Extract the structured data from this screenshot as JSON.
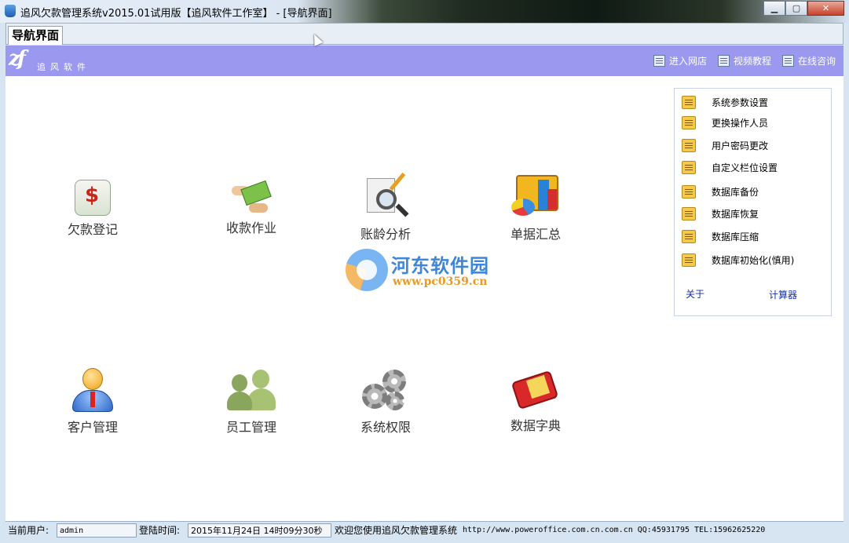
{
  "window": {
    "title": "追风欠款管理系统v2015.01试用版【追风软件工作室】 - [导航界面]",
    "minimize": "▁",
    "maximize": "▢",
    "close": "✕"
  },
  "tabs": [
    {
      "label": "导航界面"
    }
  ],
  "header": {
    "logo_mark": "zf",
    "logo_text": "追风软件",
    "links": [
      {
        "label": "进入网店",
        "icon": "list-icon"
      },
      {
        "label": "视频教程",
        "icon": "list-icon"
      },
      {
        "label": "在线咨询",
        "icon": "list-icon"
      }
    ]
  },
  "nav": {
    "items": [
      {
        "label": "欠款登记",
        "icon": "debt-register-icon"
      },
      {
        "label": "收款作业",
        "icon": "money-collect-icon"
      },
      {
        "label": "账龄分析",
        "icon": "magnifier-report-icon"
      },
      {
        "label": "单据汇总",
        "icon": "chart-summary-icon"
      },
      {
        "label": "客户管理",
        "icon": "customer-icon"
      },
      {
        "label": "员工管理",
        "icon": "staff-icon"
      },
      {
        "label": "系统权限",
        "icon": "gears-icon"
      },
      {
        "label": "数据字典",
        "icon": "dictionary-book-icon"
      }
    ]
  },
  "watermark": {
    "name": "河东软件园",
    "url": "www.pc0359.cn"
  },
  "side_panel": {
    "items": [
      {
        "label": "系统参数设置"
      },
      {
        "label": "更换操作人员"
      },
      {
        "label": "用户密码更改"
      },
      {
        "label": "自定义栏位设置"
      },
      {
        "label": "数据库备份"
      },
      {
        "label": "数据库恢复"
      },
      {
        "label": "数据库压缩"
      },
      {
        "label": "数据库初始化(慎用)"
      }
    ],
    "about": "关于",
    "calculator": "计算器"
  },
  "status": {
    "user_label": "当前用户:",
    "user_value": "admin",
    "login_label": "登陆时间:",
    "login_value": "2015年11月24日 14时09分30秒",
    "welcome": "欢迎您使用追风欠款管理系统",
    "contact": "http://www.poweroffice.com.cn.com.cn QQ:45931795 TEL:15962625220"
  }
}
